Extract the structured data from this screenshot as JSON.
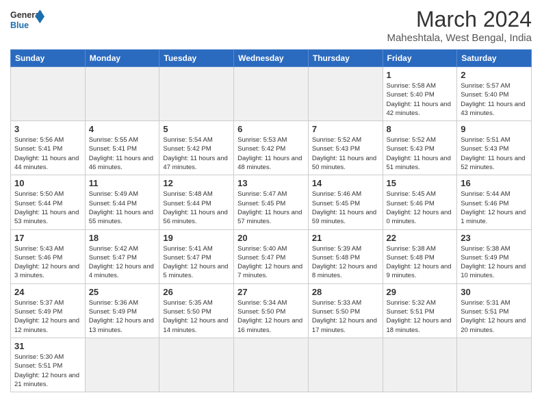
{
  "logo": {
    "text_general": "General",
    "text_blue": "Blue"
  },
  "title": "March 2024",
  "location": "Maheshtala, West Bengal, India",
  "days_of_week": [
    "Sunday",
    "Monday",
    "Tuesday",
    "Wednesday",
    "Thursday",
    "Friday",
    "Saturday"
  ],
  "weeks": [
    [
      {
        "day": "",
        "empty": true
      },
      {
        "day": "",
        "empty": true
      },
      {
        "day": "",
        "empty": true
      },
      {
        "day": "",
        "empty": true
      },
      {
        "day": "",
        "empty": true
      },
      {
        "day": "1",
        "sunrise": "5:58 AM",
        "sunset": "5:40 PM",
        "daylight": "11 hours and 42 minutes."
      },
      {
        "day": "2",
        "sunrise": "5:57 AM",
        "sunset": "5:40 PM",
        "daylight": "11 hours and 43 minutes."
      }
    ],
    [
      {
        "day": "3",
        "sunrise": "5:56 AM",
        "sunset": "5:41 PM",
        "daylight": "11 hours and 44 minutes."
      },
      {
        "day": "4",
        "sunrise": "5:55 AM",
        "sunset": "5:41 PM",
        "daylight": "11 hours and 46 minutes."
      },
      {
        "day": "5",
        "sunrise": "5:54 AM",
        "sunset": "5:42 PM",
        "daylight": "11 hours and 47 minutes."
      },
      {
        "day": "6",
        "sunrise": "5:53 AM",
        "sunset": "5:42 PM",
        "daylight": "11 hours and 48 minutes."
      },
      {
        "day": "7",
        "sunrise": "5:52 AM",
        "sunset": "5:43 PM",
        "daylight": "11 hours and 50 minutes."
      },
      {
        "day": "8",
        "sunrise": "5:52 AM",
        "sunset": "5:43 PM",
        "daylight": "11 hours and 51 minutes."
      },
      {
        "day": "9",
        "sunrise": "5:51 AM",
        "sunset": "5:43 PM",
        "daylight": "11 hours and 52 minutes."
      }
    ],
    [
      {
        "day": "10",
        "sunrise": "5:50 AM",
        "sunset": "5:44 PM",
        "daylight": "11 hours and 53 minutes."
      },
      {
        "day": "11",
        "sunrise": "5:49 AM",
        "sunset": "5:44 PM",
        "daylight": "11 hours and 55 minutes."
      },
      {
        "day": "12",
        "sunrise": "5:48 AM",
        "sunset": "5:44 PM",
        "daylight": "11 hours and 56 minutes."
      },
      {
        "day": "13",
        "sunrise": "5:47 AM",
        "sunset": "5:45 PM",
        "daylight": "11 hours and 57 minutes."
      },
      {
        "day": "14",
        "sunrise": "5:46 AM",
        "sunset": "5:45 PM",
        "daylight": "11 hours and 59 minutes."
      },
      {
        "day": "15",
        "sunrise": "5:45 AM",
        "sunset": "5:46 PM",
        "daylight": "12 hours and 0 minutes."
      },
      {
        "day": "16",
        "sunrise": "5:44 AM",
        "sunset": "5:46 PM",
        "daylight": "12 hours and 1 minute."
      }
    ],
    [
      {
        "day": "17",
        "sunrise": "5:43 AM",
        "sunset": "5:46 PM",
        "daylight": "12 hours and 3 minutes."
      },
      {
        "day": "18",
        "sunrise": "5:42 AM",
        "sunset": "5:47 PM",
        "daylight": "12 hours and 4 minutes."
      },
      {
        "day": "19",
        "sunrise": "5:41 AM",
        "sunset": "5:47 PM",
        "daylight": "12 hours and 5 minutes."
      },
      {
        "day": "20",
        "sunrise": "5:40 AM",
        "sunset": "5:47 PM",
        "daylight": "12 hours and 7 minutes."
      },
      {
        "day": "21",
        "sunrise": "5:39 AM",
        "sunset": "5:48 PM",
        "daylight": "12 hours and 8 minutes."
      },
      {
        "day": "22",
        "sunrise": "5:38 AM",
        "sunset": "5:48 PM",
        "daylight": "12 hours and 9 minutes."
      },
      {
        "day": "23",
        "sunrise": "5:38 AM",
        "sunset": "5:49 PM",
        "daylight": "12 hours and 10 minutes."
      }
    ],
    [
      {
        "day": "24",
        "sunrise": "5:37 AM",
        "sunset": "5:49 PM",
        "daylight": "12 hours and 12 minutes."
      },
      {
        "day": "25",
        "sunrise": "5:36 AM",
        "sunset": "5:49 PM",
        "daylight": "12 hours and 13 minutes."
      },
      {
        "day": "26",
        "sunrise": "5:35 AM",
        "sunset": "5:50 PM",
        "daylight": "12 hours and 14 minutes."
      },
      {
        "day": "27",
        "sunrise": "5:34 AM",
        "sunset": "5:50 PM",
        "daylight": "12 hours and 16 minutes."
      },
      {
        "day": "28",
        "sunrise": "5:33 AM",
        "sunset": "5:50 PM",
        "daylight": "12 hours and 17 minutes."
      },
      {
        "day": "29",
        "sunrise": "5:32 AM",
        "sunset": "5:51 PM",
        "daylight": "12 hours and 18 minutes."
      },
      {
        "day": "30",
        "sunrise": "5:31 AM",
        "sunset": "5:51 PM",
        "daylight": "12 hours and 20 minutes."
      }
    ],
    [
      {
        "day": "31",
        "sunrise": "5:30 AM",
        "sunset": "5:51 PM",
        "daylight": "12 hours and 21 minutes."
      },
      {
        "day": "",
        "empty": true
      },
      {
        "day": "",
        "empty": true
      },
      {
        "day": "",
        "empty": true
      },
      {
        "day": "",
        "empty": true
      },
      {
        "day": "",
        "empty": true
      },
      {
        "day": "",
        "empty": true
      }
    ]
  ]
}
